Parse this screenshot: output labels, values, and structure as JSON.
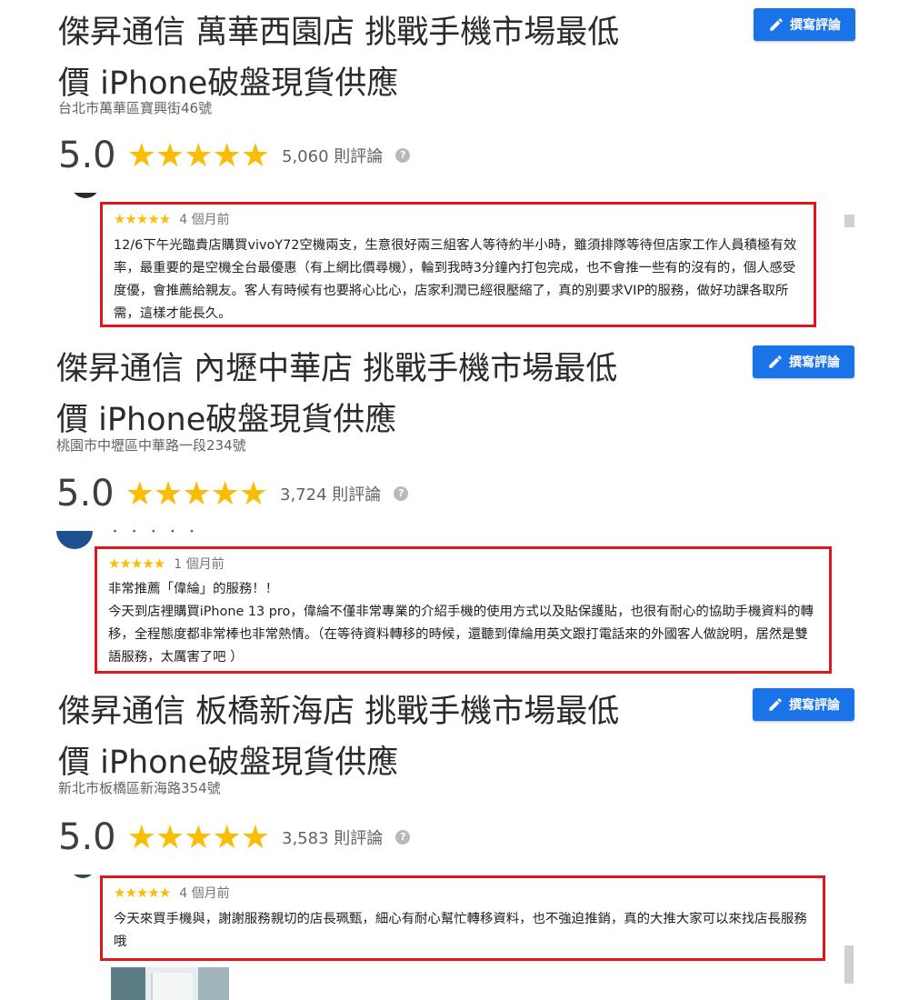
{
  "stores": [
    {
      "title_line1": "傑昇通信 萬華西園店 挑戰手機市場最低",
      "title_line2": "價 iPhone破盤現貨供應",
      "address": "台北市萬華區寶興街46號",
      "rating": "5.0",
      "stars": "★★★★★",
      "review_count": "5,060 則評論",
      "write_review_label": "撰寫評論",
      "review": {
        "stars": "★★★★★",
        "time": "4 個月前",
        "paragraphs": [
          "12/6下午光臨貴店購買vivoY72空機兩支，生意很好兩三組客人等待約半小時，雖須排隊等待但店家工作人員積極有效率，最重要的是空機全台最優惠（有上網比價尋機），輪到我時3分鐘內打包完成，也不會推一些有的沒有的，個人感受度優，會推薦給親友。客人有時候有也要將心比心，店家利潤已經很壓縮了，真的別要求VIP的服務，做好功課各取所需，這樣才能長久。"
        ]
      }
    },
    {
      "title_line1": "傑昇通信 內壢中華店 挑戰手機市場最低",
      "title_line2": "價 iPhone破盤現貨供應",
      "address": "桃園市中壢區中華路一段234號",
      "rating": "5.0",
      "stars": "★★★★★",
      "review_count": "3,724 則評論",
      "write_review_label": "撰寫評論",
      "review": {
        "stars": "★★★★★",
        "time": "1 個月前",
        "paragraphs": [
          "非常推薦「偉綸」的服務！！",
          "今天到店裡購買iPhone 13 pro，偉綸不僅非常專業的介紹手機的使用方式以及貼保護貼，也很有耐心的協助手機資料的轉移，全程態度都非常棒也非常熱情。（在等待資料轉移的時候，還聽到偉綸用英文跟打電話來的外國客人做說明，居然是雙語服務，太厲害了吧 ）"
        ]
      }
    },
    {
      "title_line1": "傑昇通信 板橋新海店 挑戰手機市場最低",
      "title_line2": "價 iPhone破盤現貨供應",
      "address": "新北市板橋區新海路354號",
      "rating": "5.0",
      "stars": "★★★★★",
      "review_count": "3,583 則評論",
      "write_review_label": "撰寫評論",
      "review": {
        "stars": "★★★★★",
        "time": "4 個月前",
        "paragraphs": [
          "今天來買手機與，謝謝服務親切的店長珮甄，細心有耐心幫忙轉移資料，也不強迫推銷，真的大推大家可以來找店長服務哦"
        ]
      }
    }
  ],
  "icons": {
    "write_review": "pencil-icon",
    "help": "question-icon"
  },
  "colors": {
    "star": "#fbbc04",
    "button": "#1a73e8",
    "highlight_border": "#e2141c"
  }
}
